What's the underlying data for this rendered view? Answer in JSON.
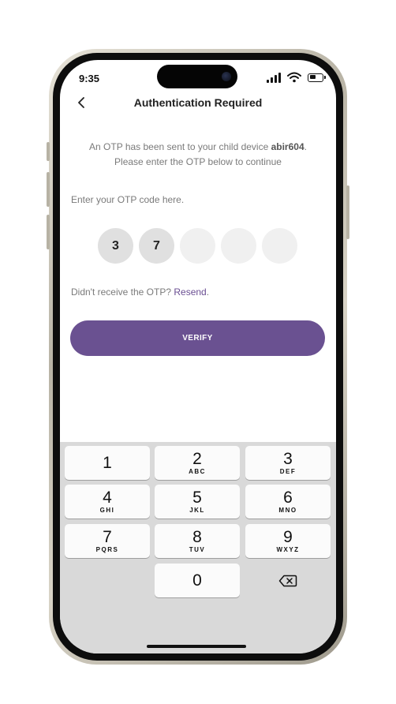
{
  "status_bar": {
    "time": "9:35"
  },
  "header": {
    "title": "Authentication Required"
  },
  "info": {
    "line1_prefix": "An OTP has been sent to your child device ",
    "device_name": "abir604",
    "line1_suffix": ".",
    "line2": "Please enter the OTP below to continue"
  },
  "otp": {
    "label": "Enter your OTP code here.",
    "digits": [
      "3",
      "7",
      "",
      "",
      ""
    ]
  },
  "resend": {
    "prompt": "Didn't receive the OTP? ",
    "link": "Resend",
    "suffix": "."
  },
  "verify_button": {
    "label": "VERIFY"
  },
  "colors": {
    "accent": "#6a5191",
    "link": "#6a4e92"
  },
  "keypad": {
    "keys": [
      {
        "digit": "1",
        "letters": ""
      },
      {
        "digit": "2",
        "letters": "ABC"
      },
      {
        "digit": "3",
        "letters": "DEF"
      },
      {
        "digit": "4",
        "letters": "GHI"
      },
      {
        "digit": "5",
        "letters": "JKL"
      },
      {
        "digit": "6",
        "letters": "MNO"
      },
      {
        "digit": "7",
        "letters": "PQRS"
      },
      {
        "digit": "8",
        "letters": "TUV"
      },
      {
        "digit": "9",
        "letters": "WXYZ"
      },
      {
        "digit": "0",
        "letters": ""
      }
    ],
    "delete_icon": "backspace-icon"
  }
}
